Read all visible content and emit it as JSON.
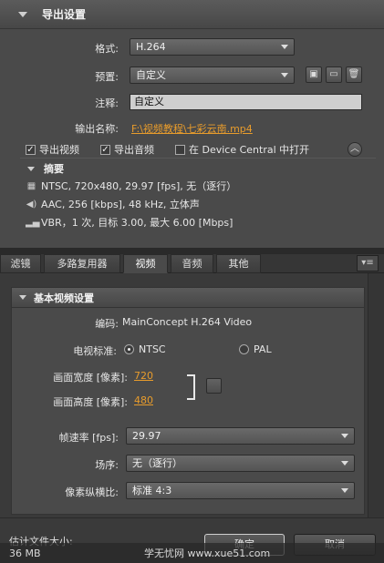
{
  "export_settings": {
    "title": "导出设置",
    "format_label": "格式:",
    "format_value": "H.264",
    "preset_label": "预置:",
    "preset_value": "自定义",
    "comment_label": "注释:",
    "comment_value": "自定义",
    "output_name_label": "输出名称:",
    "output_name_value": "F:\\视频教程\\七彩云南.mp4",
    "export_video_label": "导出视频",
    "export_audio_label": "导出音频",
    "device_central_label": "在 Device Central 中打开",
    "export_video_checked": true,
    "export_audio_checked": true,
    "device_central_checked": false
  },
  "summary": {
    "title": "摘要",
    "lines": [
      "NTSC, 720x480, 29.97 [fps], 无（逐行）",
      "AAC, 256 [kbps], 48 kHz, 立体声",
      "VBR，1 次, 目标 3.00, 最大 6.00 [Mbps]"
    ]
  },
  "tabs": [
    "滤镜",
    "多路复用器",
    "视频",
    "音频",
    "其他"
  ],
  "active_tab": "视频",
  "video": {
    "section_title": "基本视频设置",
    "codec_label": "编码:",
    "codec_value": "MainConcept H.264 Video",
    "tv_standard_label": "电视标准:",
    "ntsc_label": "NTSC",
    "pal_label": "PAL",
    "selected_standard": "NTSC",
    "width_label": "画面宽度 [像素]:",
    "width_value": "720",
    "height_label": "画面高度 [像素]:",
    "height_value": "480",
    "frame_rate_label": "帧速率 [fps]:",
    "frame_rate_value": "29.97",
    "field_order_label": "场序:",
    "field_order_value": "无（逐行）",
    "pixel_aspect_label": "像素纵横比:",
    "pixel_aspect_value": "标准 4:3"
  },
  "footer": {
    "estimated_size_label": "估计文件大小:",
    "estimated_size_value": "36 MB",
    "ok_label": "确定",
    "cancel_label": "取消",
    "watermark": "学无忧网 www.xue51.com"
  },
  "colors": {
    "accent": "#e89c2c",
    "panel_bg": "#4a4a4a"
  }
}
